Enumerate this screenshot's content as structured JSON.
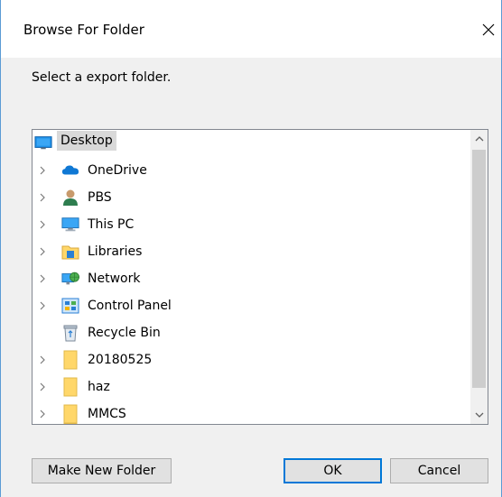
{
  "dialog": {
    "title": "Browse For Folder",
    "prompt": "Select a export folder."
  },
  "tree": {
    "root": {
      "label": "Desktop",
      "icon": "desktop-icon"
    },
    "items": [
      {
        "label": "OneDrive",
        "icon": "onedrive-cloud-icon",
        "expandable": true
      },
      {
        "label": "PBS",
        "icon": "user-icon",
        "expandable": true
      },
      {
        "label": "This PC",
        "icon": "computer-icon",
        "expandable": true
      },
      {
        "label": "Libraries",
        "icon": "libraries-icon",
        "expandable": true
      },
      {
        "label": "Network",
        "icon": "network-icon",
        "expandable": true
      },
      {
        "label": "Control Panel",
        "icon": "control-panel-icon",
        "expandable": true
      },
      {
        "label": "Recycle Bin",
        "icon": "recycle-bin-icon",
        "expandable": false
      },
      {
        "label": "20180525",
        "icon": "folder-icon",
        "expandable": true
      },
      {
        "label": "haz",
        "icon": "folder-icon",
        "expandable": true
      },
      {
        "label": "MMCS",
        "icon": "folder-icon",
        "expandable": true
      }
    ]
  },
  "buttons": {
    "make_new_folder": "Make New Folder",
    "ok": "OK",
    "cancel": "Cancel"
  },
  "colors": {
    "accent": "#0078d7",
    "folder": "#ffd76a",
    "selection": "#d9d9d9"
  }
}
